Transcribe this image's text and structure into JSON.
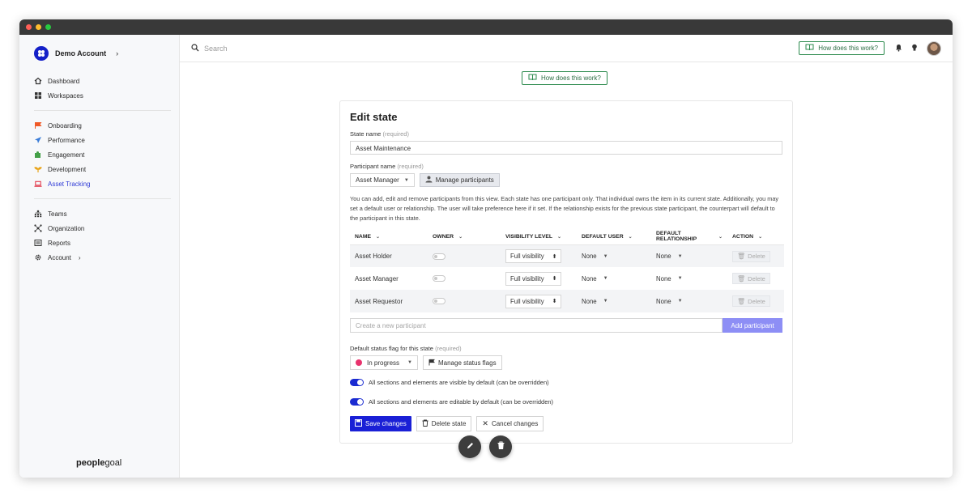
{
  "account": {
    "name": "Demo Account"
  },
  "sidebar": {
    "group1": [
      {
        "label": "Dashboard",
        "icon": "home-icon"
      },
      {
        "label": "Workspaces",
        "icon": "grid-icon"
      }
    ],
    "group2": [
      {
        "label": "Onboarding",
        "icon": "flag-icon",
        "color": "#f05a28"
      },
      {
        "label": "Performance",
        "icon": "paper-plane-icon",
        "color": "#3b7dd8"
      },
      {
        "label": "Engagement",
        "icon": "puzzle-icon",
        "color": "#44a048"
      },
      {
        "label": "Development",
        "icon": "sprout-icon",
        "color": "#e8a317"
      },
      {
        "label": "Asset Tracking",
        "icon": "laptop-icon",
        "color": "#e0263a",
        "active": true
      }
    ],
    "group3": [
      {
        "label": "Teams",
        "icon": "teams-icon"
      },
      {
        "label": "Organization",
        "icon": "org-icon"
      },
      {
        "label": "Reports",
        "icon": "reports-icon"
      },
      {
        "label": "Account",
        "icon": "gear-icon"
      }
    ],
    "brand_bold": "people",
    "brand_light": "goal"
  },
  "topbar": {
    "search_placeholder": "Search",
    "how_label": "How does this work?"
  },
  "center_how_label": "How does this work?",
  "form": {
    "title": "Edit state",
    "state_name_label": "State name",
    "required": "(required)",
    "state_name_value": "Asset Maintenance",
    "participant_label": "Participant name",
    "participant_value": "Asset Manager",
    "manage_participants": "Manage participants",
    "help_text": "You can add, edit and remove participants from this view. Each state has one participant only. That individual owns the item in its current state. Additionally, you may set a default user or relationship. The user will take preference here if it set. If the relationship exists for the previous state participant, the counterpart will default to the participant in this state.",
    "columns": {
      "name": "NAME",
      "owner": "OWNER",
      "visibility": "VISIBILITY LEVEL",
      "default_user": "DEFAULT USER",
      "default_rel_1": "DEFAULT",
      "default_rel_2": "RELATIONSHIP",
      "action": "ACTION"
    },
    "rows": [
      {
        "name": "Asset Holder",
        "visibility": "Full visibility",
        "user": "None",
        "relationship": "None",
        "action": "Delete"
      },
      {
        "name": "Asset Manager",
        "visibility": "Full visibility",
        "user": "None",
        "relationship": "None",
        "action": "Delete"
      },
      {
        "name": "Asset Requestor",
        "visibility": "Full visibility",
        "user": "None",
        "relationship": "None",
        "action": "Delete"
      }
    ],
    "new_participant_placeholder": "Create a new participant",
    "add_participant": "Add participant",
    "status_flag_label": "Default status flag for this state",
    "status_value": "In progress",
    "status_color": "#e8336d",
    "manage_status_flags": "Manage status flags",
    "toggle_visible": "All sections and elements are visible by default (can be overridden)",
    "toggle_editable": "All sections and elements are editable by default (can be overridden)",
    "save": "Save changes",
    "delete_state": "Delete state",
    "cancel": "Cancel changes"
  },
  "colors": {
    "accent": "#1a20d6",
    "help_green": "#2c8a4d"
  }
}
